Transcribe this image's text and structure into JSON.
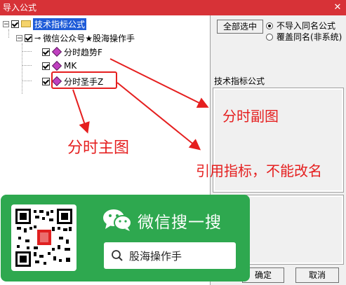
{
  "window": {
    "title": "导入公式",
    "close_glyph": "✕"
  },
  "tree": {
    "root": {
      "label": "技术指标公式",
      "expander": "−"
    },
    "group": {
      "label": "微信公众号★股海操作手",
      "expander": "−"
    },
    "items": [
      {
        "label": "分时趋势F"
      },
      {
        "label": "MK"
      },
      {
        "label": "分时圣手Z"
      }
    ]
  },
  "right": {
    "select_all_label": "全部选中",
    "radio_options": [
      {
        "label": "不导入同名公式",
        "selected": true
      },
      {
        "label": "覆盖同名(非系统)",
        "selected": false
      }
    ],
    "formula_label": "技术指标公式",
    "ok_label": "确定",
    "cancel_label": "取消"
  },
  "annotations": {
    "sub_chart": "分时副图",
    "main_chart": "分时主图",
    "ref_indicator": "引用指标，不能改名",
    "color": "#e51f1f"
  },
  "wechat": {
    "title": "微信搜一搜",
    "search_text": "股海操作手",
    "bg_color": "#2ea84f"
  },
  "colors": {
    "titlebar": "#d73237",
    "selection": "#1e5bd8"
  }
}
